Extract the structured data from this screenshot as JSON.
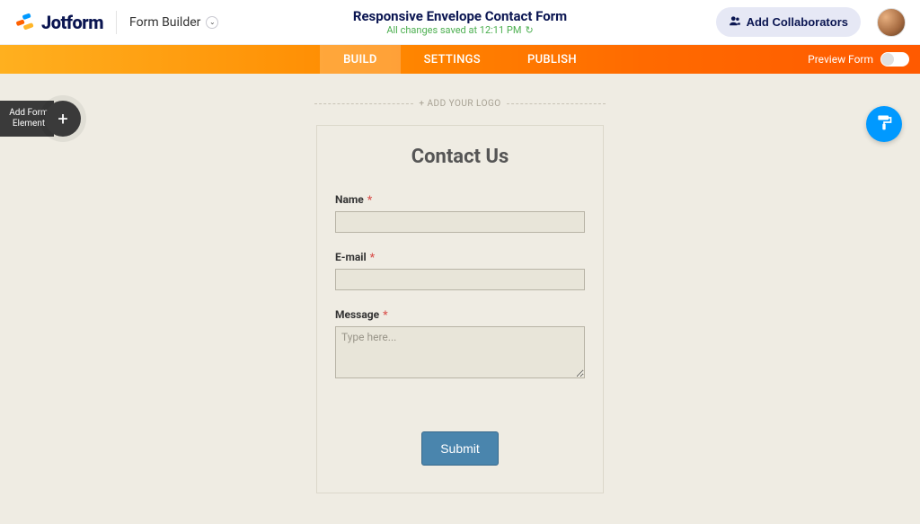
{
  "brand": {
    "name": "Jotform"
  },
  "header": {
    "builder_label": "Form Builder",
    "title": "Responsive Envelope Contact Form",
    "save_status": "All changes saved at 12:11 PM",
    "add_collaborators": "Add Collaborators"
  },
  "nav": {
    "tabs": {
      "build": "BUILD",
      "settings": "SETTINGS",
      "publish": "PUBLISH"
    },
    "preview_label": "Preview Form"
  },
  "sidebar": {
    "add_element_label": "Add Form Element"
  },
  "canvas": {
    "add_logo": "+ ADD YOUR LOGO"
  },
  "form": {
    "heading": "Contact Us",
    "fields": {
      "name": {
        "label": "Name",
        "value": ""
      },
      "email": {
        "label": "E-mail",
        "value": ""
      },
      "message": {
        "label": "Message",
        "placeholder": "Type here...",
        "value": ""
      }
    },
    "submit_label": "Submit"
  }
}
